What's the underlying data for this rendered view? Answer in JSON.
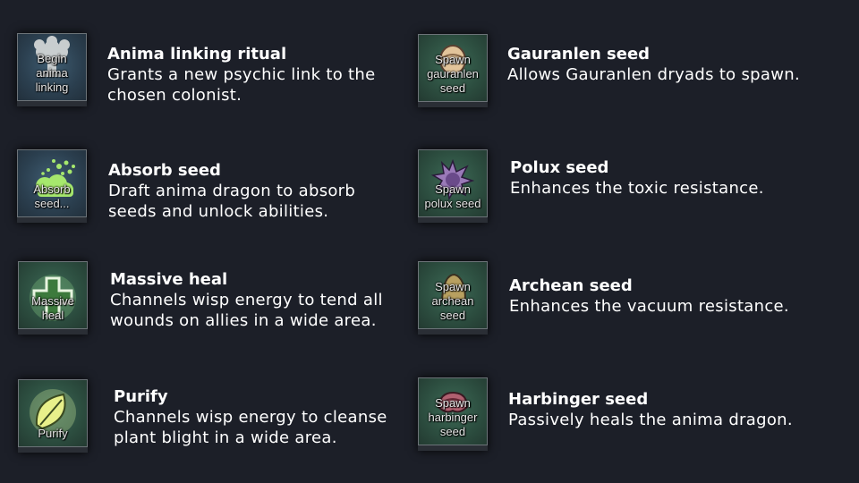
{
  "abilities_left": [
    {
      "caption": "Begin\nanima\nlinking",
      "icon": "tree-icon",
      "title": "Anima linking ritual",
      "description": "Grants a new psychic link to the chosen colonist."
    },
    {
      "caption": "Absorb\nseed...",
      "icon": "absorb-seed-icon",
      "title": "Absorb seed",
      "description": "Draft anima dragon to absorb seeds and unlock abilities."
    },
    {
      "caption": "Massive\nheal",
      "icon": "heal-cross-icon",
      "title": "Massive heal",
      "description": "Channels wisp energy to tend all wounds on allies in a wide area."
    },
    {
      "caption": "Purify",
      "icon": "leaf-icon",
      "title": "Purify",
      "description": "Channels wisp energy to cleanse plant blight in a wide area."
    }
  ],
  "abilities_right": [
    {
      "caption": "Spawn\ngauranlen\nseed",
      "icon": "gauranlen-seed-icon",
      "title": "Gauranlen seed",
      "description": "Allows Gauranlen dryads to spawn."
    },
    {
      "caption": "Spawn\npolux seed",
      "icon": "polux-seed-icon",
      "title": "Polux seed",
      "description": "Enhances the toxic resistance."
    },
    {
      "caption": "Spawn\narchean\nseed",
      "icon": "archean-seed-icon",
      "title": "Archean seed",
      "description": "Enhances the vacuum resistance."
    },
    {
      "caption": "Spawn\nharbinger\nseed",
      "icon": "harbinger-seed-icon",
      "title": "Harbinger seed",
      "description": "Passively heals the anima dragon."
    }
  ],
  "colors": {
    "background": "#1c1f28",
    "text": "#ffffff",
    "button_blue": "#2b3f4f",
    "button_green": "#2c4d3f"
  }
}
